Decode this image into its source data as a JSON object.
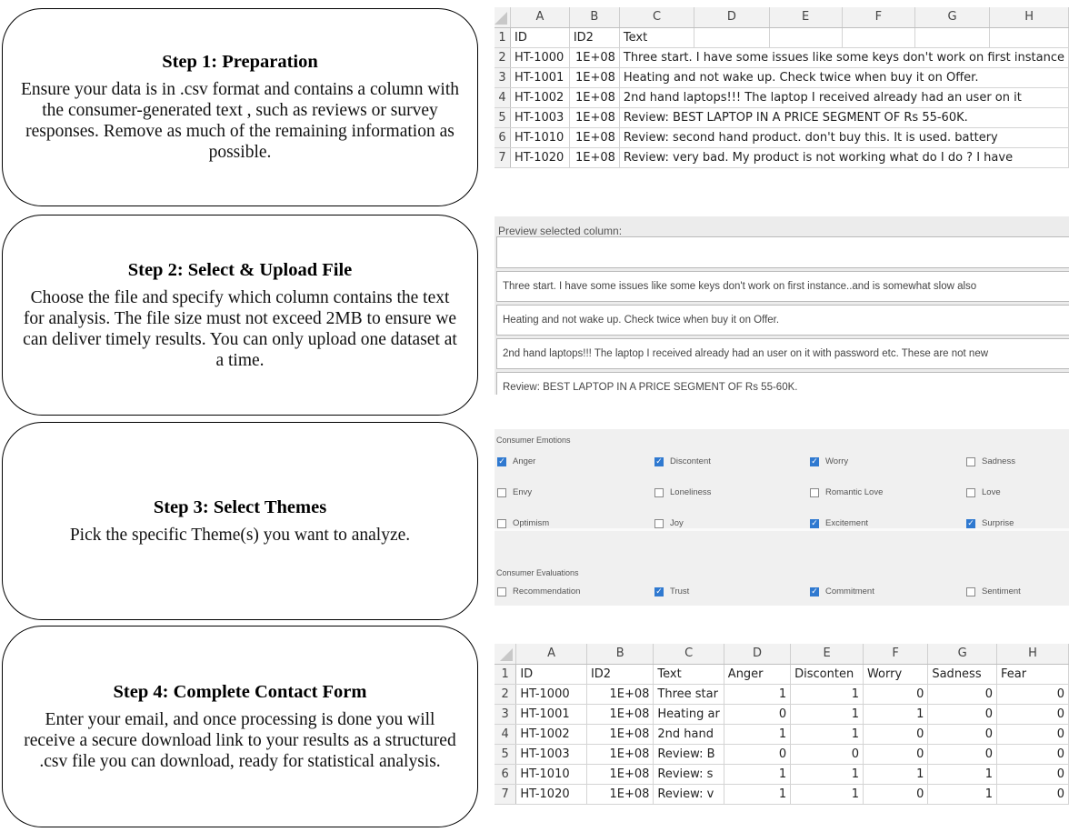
{
  "steps": [
    {
      "title": "Step 1: Preparation",
      "body": "Ensure your data is in .csv format and contains a column with the consumer-generated text , such as reviews or survey responses. Remove as much of the remaining information as possible."
    },
    {
      "title": "Step 2: Select & Upload File",
      "body": "Choose the file and specify which column contains the text for analysis. The file size must not exceed 2MB to ensure we can deliver timely results. You can only upload one dataset at a time."
    },
    {
      "title": "Step 3: Select Themes",
      "body": "Pick the specific Theme(s) you want to analyze."
    },
    {
      "title": "Step 4: Complete Contact Form",
      "body": "Enter your email, and once processing is done you will receive a secure download link to your results as a structured .csv file you can download, ready for statistical analysis."
    }
  ],
  "sheet1": {
    "columns": [
      "A",
      "B",
      "C",
      "D",
      "E",
      "F",
      "G",
      "H"
    ],
    "rows": [
      {
        "num": "1",
        "cells": [
          "ID",
          "ID2",
          "Text",
          "",
          "",
          "",
          "",
          ""
        ]
      },
      {
        "num": "2",
        "cells": [
          "HT-1000",
          "1E+08",
          "Three start. I have some issues like some keys don't work on first instance",
          "",
          "",
          "",
          "",
          ""
        ]
      },
      {
        "num": "3",
        "cells": [
          "HT-1001",
          "1E+08",
          "Heating and not wake up. Check twice when buy it on Offer.",
          "",
          "",
          "",
          "",
          ""
        ]
      },
      {
        "num": "4",
        "cells": [
          "HT-1002",
          "1E+08",
          "2nd hand laptops!!! The laptop I received already had an user on it",
          "",
          "",
          "",
          "",
          ""
        ]
      },
      {
        "num": "5",
        "cells": [
          "HT-1003",
          "1E+08",
          "Review: BEST LAPTOP IN A PRICE SEGMENT OF Rs 55-60K.",
          "",
          "",
          "",
          "",
          ""
        ]
      },
      {
        "num": "6",
        "cells": [
          "HT-1010",
          "1E+08",
          "Review: second hand product. don't buy this. It is used. battery",
          "",
          "",
          "",
          "",
          ""
        ]
      },
      {
        "num": "7",
        "cells": [
          "HT-1020",
          "1E+08",
          "Review: very bad. My product is not working what do I do ? I have",
          "",
          "",
          "",
          "",
          ""
        ]
      }
    ]
  },
  "preview": {
    "label": "Preview selected column:",
    "rows": [
      "",
      "Three start. I have some issues like some keys don't work on first instance..and is somewhat slow also",
      "Heating and not wake up. Check twice when buy it on Offer.",
      "2nd hand laptops!!! The laptop I received already had an user on it with password etc. These are not new",
      "Review: BEST LAPTOP IN A PRICE SEGMENT OF Rs 55-60K."
    ]
  },
  "themes": {
    "emotions_label": "Consumer Emotions",
    "emotions": [
      {
        "label": "Anger",
        "checked": true
      },
      {
        "label": "Discontent",
        "checked": true
      },
      {
        "label": "Worry",
        "checked": true
      },
      {
        "label": "Sadness",
        "checked": false
      },
      {
        "label": "Envy",
        "checked": false
      },
      {
        "label": "Loneliness",
        "checked": false
      },
      {
        "label": "Romantic Love",
        "checked": false
      },
      {
        "label": "Love",
        "checked": false
      },
      {
        "label": "Optimism",
        "checked": false
      },
      {
        "label": "Joy",
        "checked": false
      },
      {
        "label": "Excitement",
        "checked": true
      },
      {
        "label": "Surprise",
        "checked": true
      }
    ],
    "evaluations_label": "Consumer Evaluations",
    "evaluations": [
      {
        "label": "Recommendation",
        "checked": false
      },
      {
        "label": "Trust",
        "checked": true
      },
      {
        "label": "Commitment",
        "checked": true
      },
      {
        "label": "Sentiment",
        "checked": false
      }
    ]
  },
  "sheet2": {
    "columns": [
      "A",
      "B",
      "C",
      "D",
      "E",
      "F",
      "G",
      "H"
    ],
    "rows": [
      {
        "num": "1",
        "cells": [
          "ID",
          "ID2",
          "Text",
          "Anger",
          "Disconten",
          "Worry",
          "Sadness",
          "Fear"
        ]
      },
      {
        "num": "2",
        "cells": [
          "HT-1000",
          "1E+08",
          "Three star",
          "1",
          "1",
          "0",
          "0",
          "0"
        ]
      },
      {
        "num": "3",
        "cells": [
          "HT-1001",
          "1E+08",
          "Heating ar",
          "0",
          "1",
          "1",
          "0",
          "0"
        ]
      },
      {
        "num": "4",
        "cells": [
          "HT-1002",
          "1E+08",
          "2nd hand",
          "1",
          "1",
          "0",
          "0",
          "0"
        ]
      },
      {
        "num": "5",
        "cells": [
          "HT-1003",
          "1E+08",
          "Review: B",
          "0",
          "0",
          "0",
          "0",
          "0"
        ]
      },
      {
        "num": "6",
        "cells": [
          "HT-1010",
          "1E+08",
          "Review: s",
          "1",
          "1",
          "1",
          "1",
          "0"
        ]
      },
      {
        "num": "7",
        "cells": [
          "HT-1020",
          "1E+08",
          "Review: v",
          "1",
          "1",
          "0",
          "1",
          "0"
        ]
      }
    ]
  }
}
